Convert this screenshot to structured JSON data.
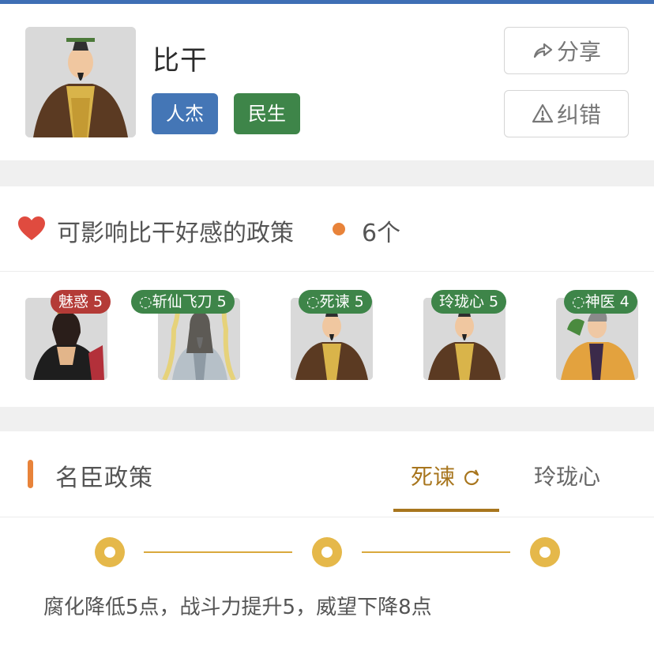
{
  "colors": {
    "top_bar": "#3f6fb5",
    "tag_blue": "#4476b6",
    "tag_green": "#3e8549",
    "badge_red": "#b43b37",
    "accent_orange": "#e8833a",
    "gold": "#a8761e",
    "node_gold": "#e5b84a"
  },
  "header": {
    "name": "比干",
    "tags": [
      "人杰",
      "民生"
    ],
    "share_label": "分享",
    "report_label": "纠错",
    "share_icon": "share-arrow-icon",
    "report_icon": "warning-triangle-icon"
  },
  "affinity": {
    "icon": "heart-icon",
    "title": "可影响比干好感的政策",
    "count": "6个",
    "policies": [
      {
        "badge": "魅惑 5",
        "color": "red"
      },
      {
        "badge": "◌斩仙飞刀 5",
        "color": "green"
      },
      {
        "badge": "◌死谏 5",
        "color": "green"
      },
      {
        "badge": "玲珑心 5",
        "color": "green"
      },
      {
        "badge": "◌神医 4",
        "color": "green"
      }
    ]
  },
  "minister_policy": {
    "title": "名臣政策",
    "tabs": [
      "死谏",
      "玲珑心"
    ],
    "active_tab_icon": "refresh-icon",
    "effect": "腐化降低5点，战斗力提升5，威望下降8点"
  }
}
